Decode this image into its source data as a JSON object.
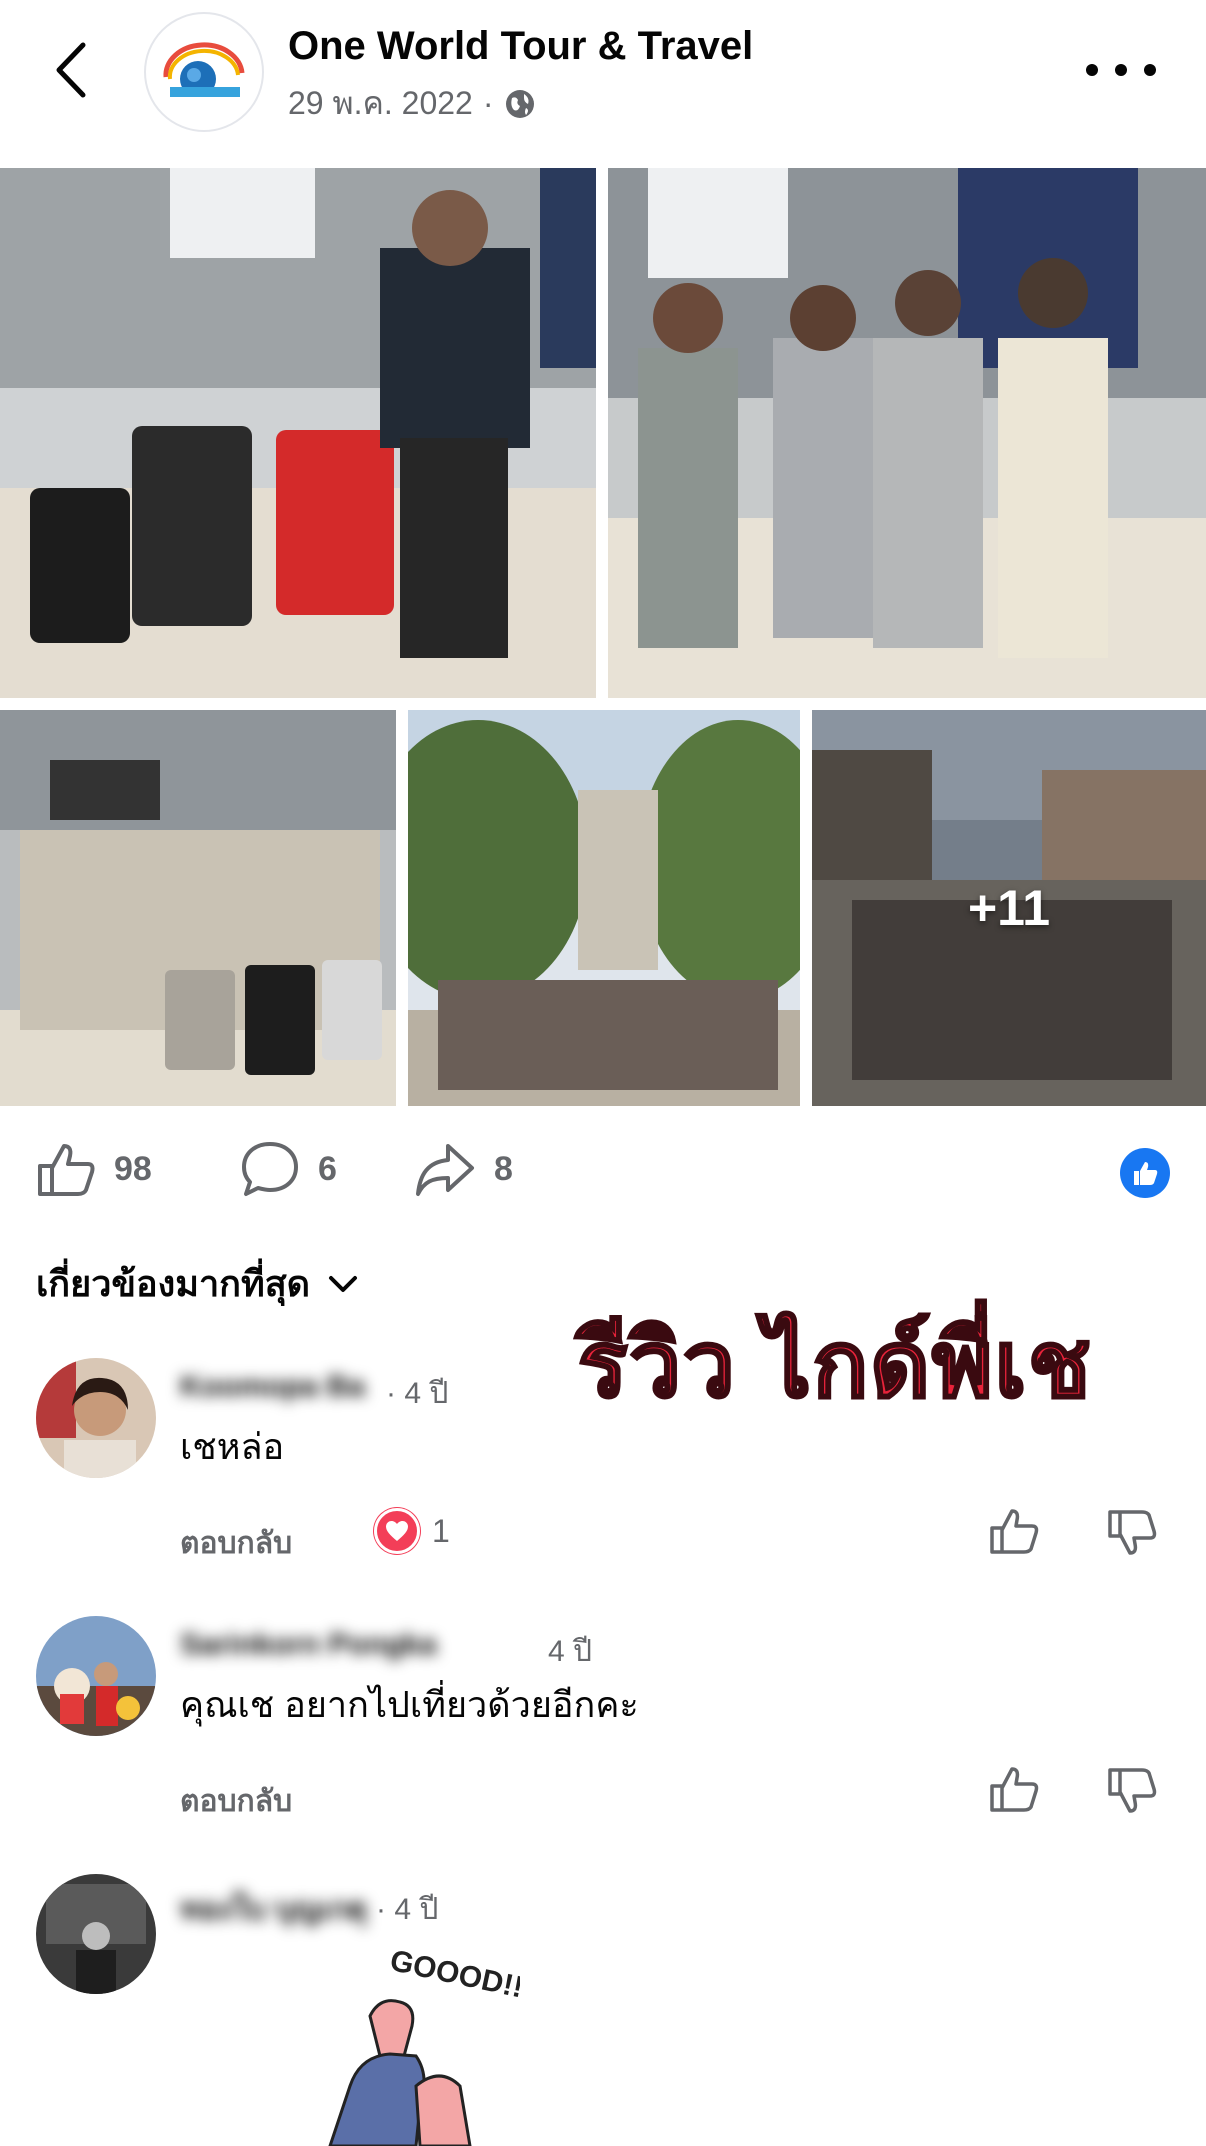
{
  "header": {
    "page_name": "One World Tour & Travel",
    "date": "29 พ.ค. 2022",
    "separator": "·",
    "privacy_icon": "globe-icon"
  },
  "photos": {
    "more_count": "+11"
  },
  "actions": {
    "likes": "98",
    "comments": "6",
    "shares": "8"
  },
  "sort": {
    "label": "เกี่ยวข้องมากที่สุด"
  },
  "overlay_caption": "รีวิว ไกด์พี่เช",
  "comments": [
    {
      "name": "Koomopa Ba",
      "time": "· 4 ปี",
      "text": "เชหล่อ",
      "reply": "ตอบกลับ",
      "reaction_count": "1"
    },
    {
      "name": "Sarinkorn Pongka",
      "time": "4 ปี",
      "text": "คุณเช อยากไปเที่ยวด้วยอีกคะ",
      "reply": "ตอบกลับ"
    },
    {
      "name": "ทองใบ บุญเกตุ",
      "time": "· 4 ปี",
      "sticker_text": "GOOOD!!"
    }
  ],
  "colors": {
    "facebook_blue": "#1877f2",
    "meta_gray": "#65676b",
    "heart_red": "#f33e58",
    "caption_red": "#e8233a"
  }
}
